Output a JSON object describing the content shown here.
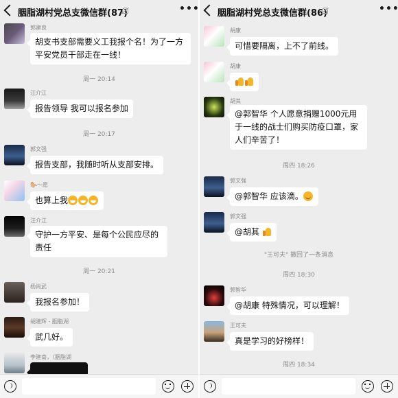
{
  "left": {
    "title": "胭脂湖村党总支微信群(87)",
    "messages": [
      {
        "sender": "郭建良",
        "text": "胡支书支部需要义工我报个名！为了一方平安党员干部走在一线！"
      },
      {
        "time": "周一 20:14"
      },
      {
        "sender": "汪介江",
        "text": "报告领导  我可以报名参加"
      },
      {
        "time": "周一 20:17"
      },
      {
        "sender": "郭文强",
        "text": "报告支部，我随时听从支部安排。"
      },
      {
        "sender": "🐎〜愿",
        "text": "也算上我"
      },
      {
        "sender": "汪介江",
        "text": "守护一方平安、是每个公民应尽的责任"
      },
      {
        "time": "周一 20:21"
      },
      {
        "sender": "杨尚武",
        "text": "我报名参加！"
      },
      {
        "sender": "胡建辉 - 胭脂湖",
        "text": "武几好。"
      },
      {
        "sender": "李建南，（胭脂湖"
      }
    ]
  },
  "right": {
    "title": "胭脂湖村党总支微信群(86)",
    "messages": [
      {
        "sender": "胡康",
        "text": "可惜要隔离，上不了前线。"
      },
      {
        "sender": "胡康",
        "text": ""
      },
      {
        "sender": "胡其",
        "text": "@郭智华  个人愿意捐赠1000元用于一线的战士们购买防疫口罩，家人们辛苦了！"
      },
      {
        "time": "周四 18:26"
      },
      {
        "sender": "郭文强",
        "text": "@郭智华  应该滴。"
      },
      {
        "sender": "郭文强",
        "text": "@胡其 "
      },
      {
        "system": "\"王可夫\" 撤回了一条消息"
      },
      {
        "time": "周四 18:30"
      },
      {
        "sender": "郭智华",
        "text": "@胡康  特殊情况，可以理解！"
      },
      {
        "sender": "王可夫",
        "text": "真是学习的好榜样！"
      },
      {
        "time": "周四 18:34"
      }
    ]
  },
  "icons": {
    "back": "back-chevron-icon",
    "mute": "mute-bell-icon",
    "more": "more-dots-icon",
    "voice": "voice-input-icon",
    "emoji": "emoji-icon",
    "plus": "plus-icon"
  },
  "colors": {
    "background": "#ededed",
    "bubble": "#ffffff",
    "meta_text": "#8a8a8a"
  }
}
